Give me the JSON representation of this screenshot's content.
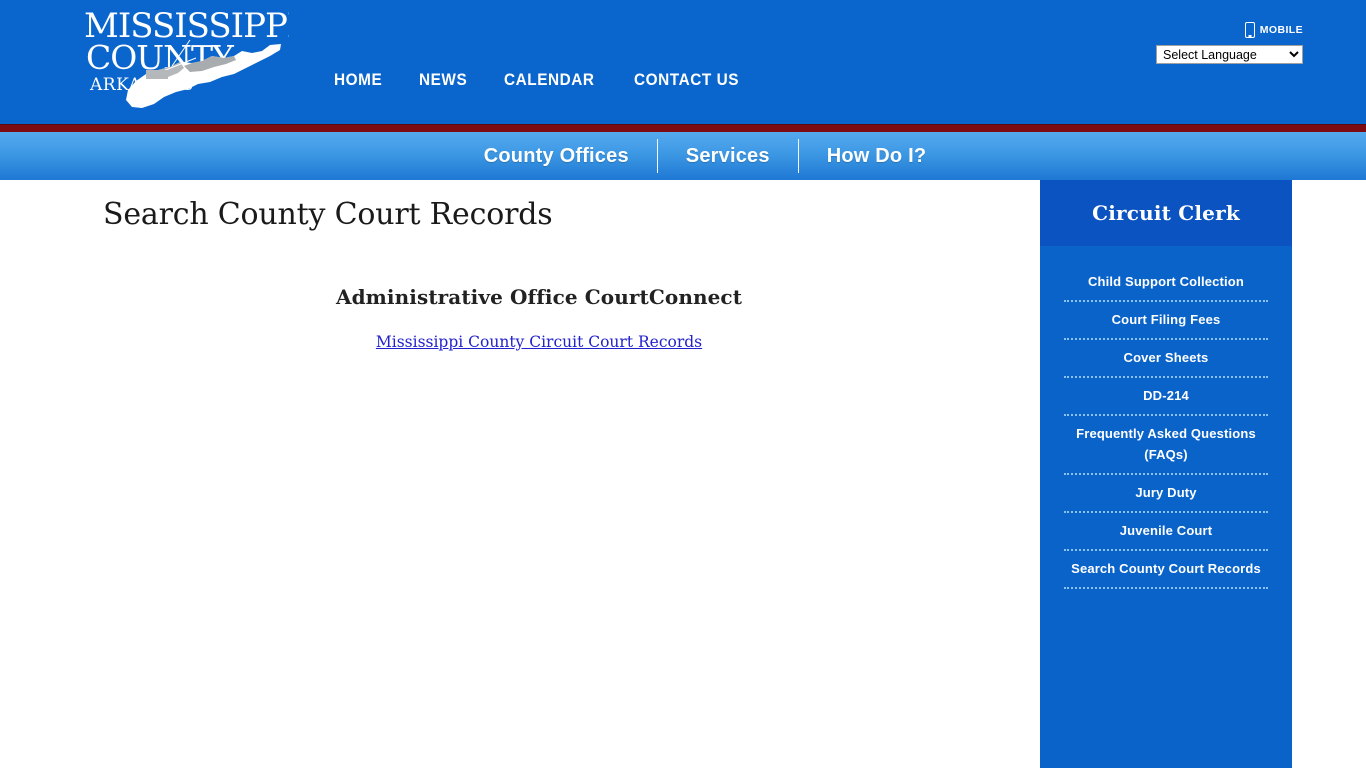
{
  "header": {
    "logo": {
      "line1": "MISSISSIPPI",
      "line2": "COUNTY",
      "line3": "ARKANSAS",
      "alt": "Mississippi County Arkansas seal with county map"
    },
    "nav": [
      {
        "label": "HOME"
      },
      {
        "label": "NEWS"
      },
      {
        "label": "CALENDAR"
      },
      {
        "label": "CONTACT US"
      }
    ],
    "mobile_label": "MOBILE",
    "mobile_icon": "mobile-phone-icon",
    "language_select": {
      "selected": "Select Language",
      "options": [
        "Select Language"
      ]
    },
    "background_color": "#0a66cc",
    "divider_color": "#7d0d12"
  },
  "sub_nav": {
    "items": [
      {
        "label": "County Offices"
      },
      {
        "label": "Services"
      },
      {
        "label": "How Do I?"
      }
    ],
    "gradient_from": "#55aaee",
    "gradient_to": "#1e78d4"
  },
  "main": {
    "page_title": "Search County Court Records",
    "section_heading": "Administrative Office CourtConnect",
    "link_text": "Mississippi County Circuit Court Records",
    "link_color": "#2222cc"
  },
  "sidebar": {
    "title": "Circuit Clerk",
    "background_color": "#0a63c9",
    "header_color": "#0b53c0",
    "items": [
      {
        "label": "Child Support Collection"
      },
      {
        "label": "Court Filing Fees"
      },
      {
        "label": "Cover Sheets"
      },
      {
        "label": "DD-214"
      },
      {
        "label": "Frequently Asked Questions (FAQs)"
      },
      {
        "label": "Jury Duty"
      },
      {
        "label": "Juvenile Court"
      },
      {
        "label": "Search County Court Records"
      }
    ]
  }
}
